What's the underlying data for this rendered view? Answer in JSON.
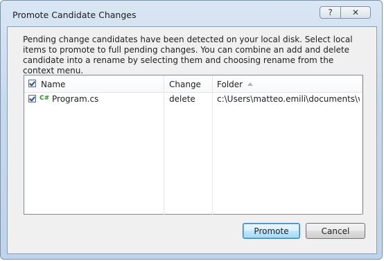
{
  "dialog": {
    "title": "Promote Candidate Changes",
    "help_glyph": "?",
    "close_glyph": "✕",
    "instructions": "Pending change candidates have been detected on your local disk. Select local items to promote to full pending changes. You can combine an add and delete candidate into a rename by selecting them and choosing rename from the context menu."
  },
  "list": {
    "columns": [
      {
        "label": "Name"
      },
      {
        "label": "Change"
      },
      {
        "label": "Folder",
        "sorted": "ascending"
      }
    ],
    "select_all_checked": true,
    "rows": [
      {
        "checked": true,
        "icon": "csharp-file-icon",
        "icon_glyph": "C#",
        "name": "Program.cs",
        "change": "delete",
        "folder": "c:\\Users\\matteo.emili\\documents\\v..."
      }
    ]
  },
  "buttons": {
    "promote": "Promote",
    "cancel": "Cancel"
  },
  "colors": {
    "icon_green": "#2e8b2e",
    "default_button_border": "#3c7fb1"
  }
}
